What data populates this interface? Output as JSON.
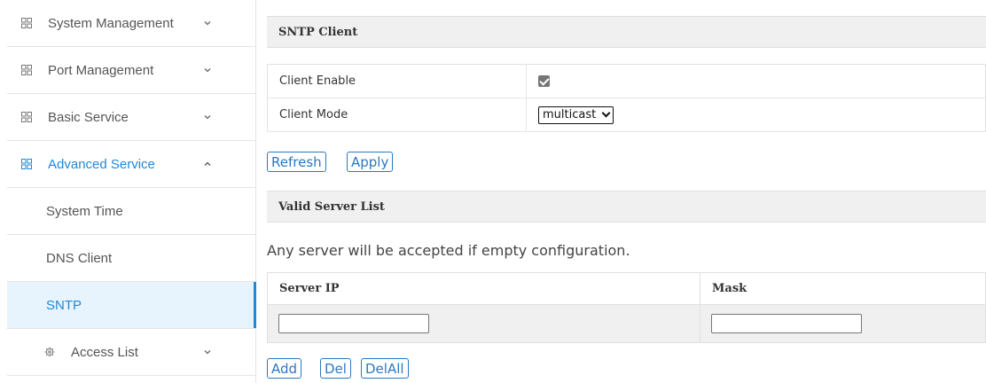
{
  "sidebar": {
    "items": [
      {
        "label": "System Management",
        "icon": "grid-icon",
        "chevron": "chevron-down-icon"
      },
      {
        "label": "Port Management",
        "icon": "grid-icon",
        "chevron": "chevron-down-icon"
      },
      {
        "label": "Basic Service",
        "icon": "grid-icon",
        "chevron": "chevron-down-icon"
      },
      {
        "label": "Advanced Service",
        "icon": "grid-icon",
        "chevron": "chevron-up-icon",
        "expanded": true
      },
      {
        "label": "System Time"
      },
      {
        "label": "DNS Client"
      },
      {
        "label": "SNTP",
        "selected": true
      },
      {
        "label": "Access List",
        "icon": "gear-icon",
        "chevron": "chevron-down-icon"
      }
    ]
  },
  "sntp_client": {
    "title": "SNTP Client",
    "enable_label": "Client Enable",
    "enable_checked": true,
    "mode_label": "Client Mode",
    "mode_value": "multicast"
  },
  "buttons": {
    "refresh": "Refresh",
    "apply": "Apply",
    "add": "Add",
    "del": "Del",
    "delall": "DelAll"
  },
  "server_list": {
    "title": "Valid Server List",
    "note": "Any server will be accepted if empty configuration.",
    "columns": [
      "Server IP",
      "Mask"
    ],
    "ip_value": "",
    "mask_value": ""
  },
  "colors": {
    "accent": "#1e88d9",
    "button": "#2a78c2",
    "header_bg": "#f0f0f0"
  }
}
